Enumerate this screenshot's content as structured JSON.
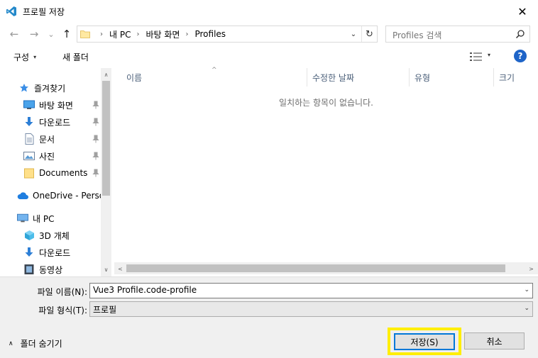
{
  "window": {
    "title": "프로필 저장",
    "close_glyph": "✕",
    "accent": "#0078d7"
  },
  "nav": {
    "back": "←",
    "forward": "→",
    "recent": "⌄",
    "up": "↑"
  },
  "address": {
    "segments": [
      "내 PC",
      "바탕 화면",
      "Profiles"
    ],
    "separator": "›",
    "dropdown_glyph": "⌄",
    "refresh_glyph": "↻"
  },
  "search": {
    "placeholder": "Profiles 검색"
  },
  "toolbar": {
    "organize_label": "구성",
    "organize_caret": "▾",
    "new_folder_label": "새 폴더",
    "view_caret": "▾",
    "help_glyph": "?"
  },
  "sidebar": {
    "quick_access": "즐겨찾기",
    "items": [
      {
        "label": "바탕 화면",
        "icon": "desktop-icon",
        "pinned": true
      },
      {
        "label": "다운로드",
        "icon": "download-icon",
        "pinned": true
      },
      {
        "label": "문서",
        "icon": "document-icon",
        "pinned": true
      },
      {
        "label": "사진",
        "icon": "pictures-icon",
        "pinned": true
      },
      {
        "label": "Documents",
        "icon": "folder-icon",
        "pinned": true
      }
    ],
    "onedrive": "OneDrive - Persor",
    "this_pc": "내 PC",
    "pc_items": [
      {
        "label": "3D 개체",
        "icon": "3d-objects-icon"
      },
      {
        "label": "다운로드",
        "icon": "download-icon"
      },
      {
        "label": "동영상",
        "icon": "video-icon"
      }
    ],
    "scroll_up": "∧",
    "scroll_down": "∨"
  },
  "file_list": {
    "columns": [
      "이름",
      "수정한 날짜",
      "유형",
      "크기"
    ],
    "sort_glyph": "^",
    "empty_message": "일치하는 항목이 없습니다.",
    "scroll_left": "<",
    "scroll_right": ">"
  },
  "form": {
    "filename_label": "파일 이름(N):",
    "filename_value": "Vue3 Profile.code-profile",
    "filetype_label": "파일 형식(T):",
    "filetype_value": "프로필",
    "caret": "⌄"
  },
  "footer": {
    "hide_folders_glyph": "∧",
    "hide_folders_label": "폴더 숨기기",
    "save_label": "저장(S)",
    "cancel_label": "취소",
    "highlight_color": "#ffee00"
  }
}
